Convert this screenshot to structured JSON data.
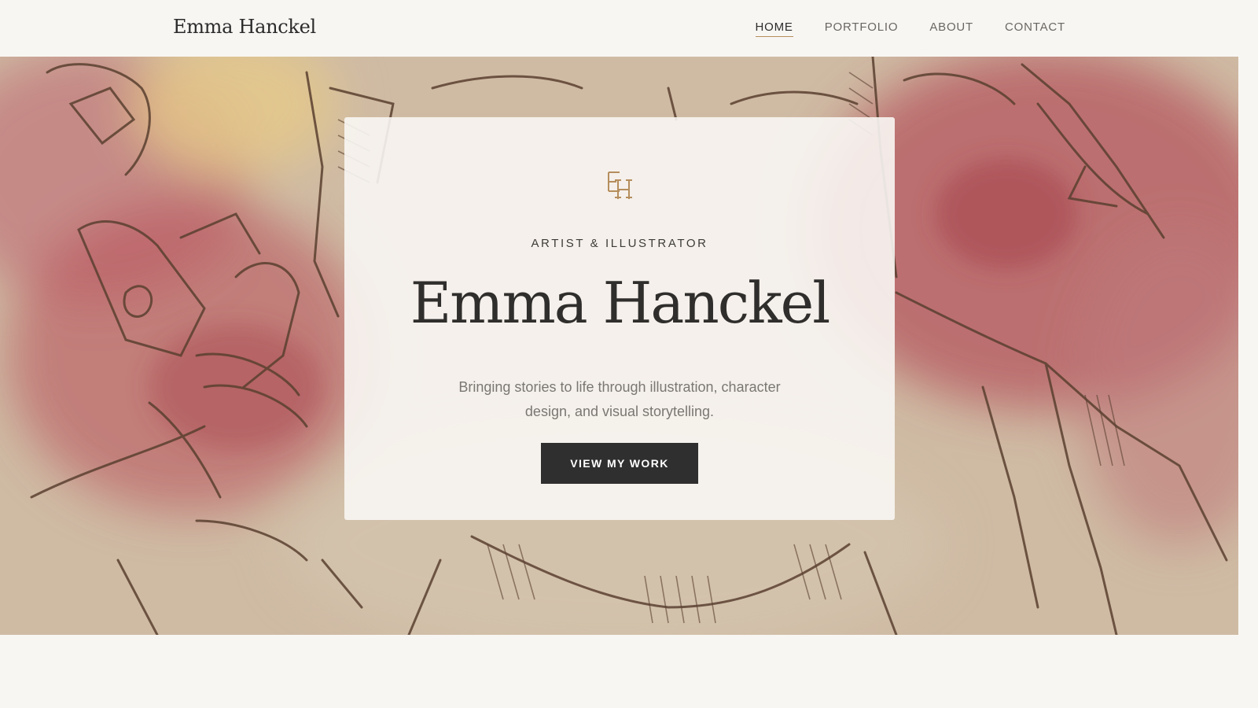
{
  "header": {
    "brand": "Emma Hanckel",
    "nav": [
      {
        "label": "HOME",
        "active": true
      },
      {
        "label": "PORTFOLIO",
        "active": false
      },
      {
        "label": "ABOUT",
        "active": false
      },
      {
        "label": "CONTACT",
        "active": false
      }
    ]
  },
  "hero": {
    "monogram": "EH",
    "eyebrow": "ARTIST & ILLUSTRATOR",
    "title": "Emma Hanckel",
    "tagline": "Bringing stories to life through illustration, character design, and visual storytelling.",
    "cta_label": "VIEW MY WORK"
  },
  "colors": {
    "accent": "#b58e5d",
    "ink": "#2f2f2f",
    "page_background": "#f8f6f2",
    "watercolor_red": "#b4505a"
  },
  "icons": {
    "monogram": "eh-monogram-icon"
  }
}
